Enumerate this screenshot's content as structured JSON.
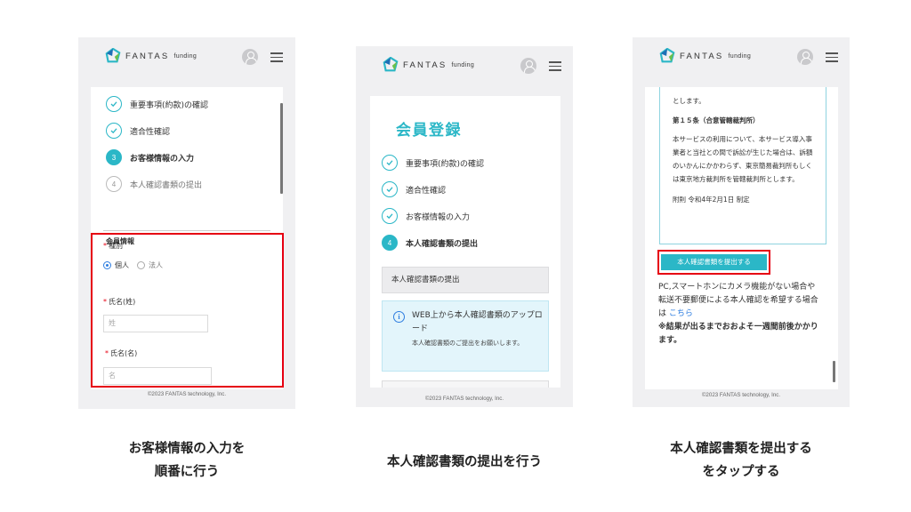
{
  "brand": {
    "name": "FANTAS",
    "sub": "funding"
  },
  "footer": "©2023 FANTAS technology, Inc.",
  "screen1": {
    "steps": [
      {
        "label": "重要事項(約款)の確認",
        "state": "done"
      },
      {
        "label": "適合性確認",
        "state": "done"
      },
      {
        "label": "お客様情報の入力",
        "state": "active",
        "num": "3"
      },
      {
        "label": "本人確認書類の提出",
        "state": "todo",
        "num": "4"
      }
    ],
    "section_title": "会員情報",
    "type_label": "種別",
    "type_options": [
      "個人",
      "法人"
    ],
    "last_name_label": "氏名(姓)",
    "last_name_placeholder": "姓",
    "first_name_label": "氏名(名)",
    "first_name_placeholder": "名",
    "required_mark": "*"
  },
  "screen2": {
    "title": "会員登録",
    "steps": [
      {
        "label": "重要事項(約款)の確認",
        "state": "done"
      },
      {
        "label": "適合性確認",
        "state": "done"
      },
      {
        "label": "お客様情報の入力",
        "state": "done"
      },
      {
        "label": "本人確認書類の提出",
        "state": "active",
        "num": "4"
      }
    ],
    "section_title": "本人確認書類の提出",
    "info_title": "WEB上から本人確認書類のアップロード",
    "info_body": "本人確認書類のご提出をお願いします。"
  },
  "screen3": {
    "terms_top": "とします。",
    "article_title": "第１５条（合意管轄裁判所）",
    "article_body": "本サービスの利用について、本サービス導入事業者と当社との間で訴訟が生じた場合は、訴額のいかんにかかわらず、東京簡易裁判所もしくは東京地方裁判所を管轄裁判所とします。",
    "appendix": "附則 令和4年2月1日 制定",
    "submit_button": "本人確認書類を提出する",
    "note_line1": "PC,スマートホンにカメラ機能がない場合や",
    "note_line2": "転送不要郵便による本人確認を希望する場合は",
    "note_link": "こちら",
    "note_bold": "※結果が出るまでおおよそ一週間前後かかります。"
  },
  "captions": {
    "c1_line1": "お客様情報の入力を",
    "c1_line2": "順番に行う",
    "c2": "本人確認書類の提出を行う",
    "c3_line1": "本人確認書類を提出する",
    "c3_line2": "をタップする"
  },
  "colors": {
    "accent": "#2bb7c7",
    "highlight": "#e60012",
    "link": "#2d7de0"
  }
}
